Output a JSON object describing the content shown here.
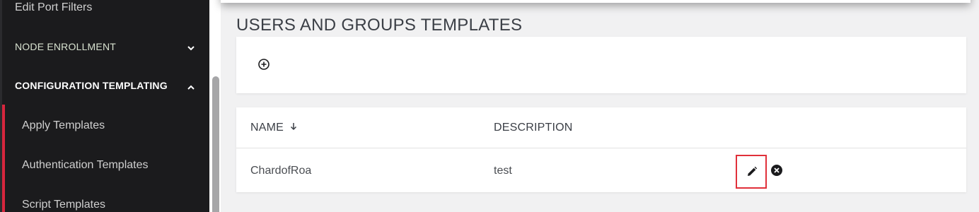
{
  "sidebar": {
    "items": [
      {
        "label": "Edit Port Filters"
      },
      {
        "label": "NODE ENROLLMENT",
        "icon": "chevron-down-icon"
      },
      {
        "label": "CONFIGURATION TEMPLATING",
        "icon": "chevron-up-icon"
      },
      {
        "label": "Apply Templates"
      },
      {
        "label": "Authentication Templates"
      },
      {
        "label": "Script Templates"
      }
    ],
    "accent_color": "#d7263d"
  },
  "main": {
    "title": "USERS AND GROUPS TEMPLATES",
    "add_icon": "plus-circle-icon",
    "table": {
      "columns": [
        {
          "label": "NAME",
          "sort_icon": "arrow-down-icon"
        },
        {
          "label": "DESCRIPTION"
        }
      ],
      "rows": [
        {
          "name": "ChardofRoa",
          "description": "test",
          "actions": [
            "pencil-icon",
            "close-circle-icon"
          ]
        }
      ]
    }
  },
  "colors": {
    "sidebar_bg": "#1b1b1d",
    "page_bg": "#f1f1f2",
    "highlight_border": "#e0303a"
  }
}
